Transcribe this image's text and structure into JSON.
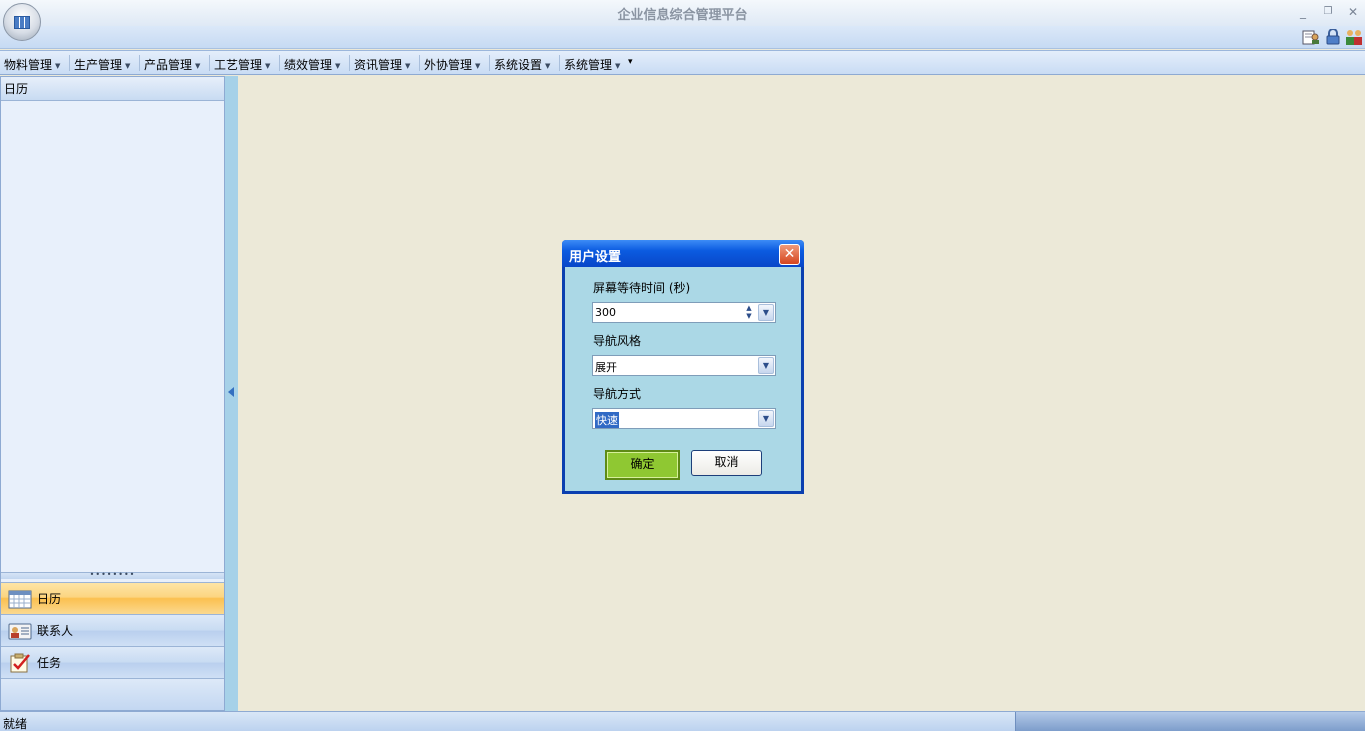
{
  "window": {
    "title": "企业信息综合管理平台",
    "minimize": "_",
    "restore": "❐",
    "close": "✕"
  },
  "menu": {
    "items": [
      {
        "label": "物料管理"
      },
      {
        "label": "生产管理"
      },
      {
        "label": "产品管理"
      },
      {
        "label": "工艺管理"
      },
      {
        "label": "绩效管理"
      },
      {
        "label": "资讯管理"
      },
      {
        "label": "外协管理"
      },
      {
        "label": "系统设置"
      },
      {
        "label": "系统管理"
      }
    ],
    "overflow": "▾"
  },
  "nav": {
    "header": "日历",
    "splitter": "••••••••",
    "buttons": [
      {
        "label": "日历",
        "icon": "calendar-icon",
        "active": true
      },
      {
        "label": "联系人",
        "icon": "contact-card-icon",
        "active": false
      },
      {
        "label": "任务",
        "icon": "task-checklist-icon",
        "active": false
      }
    ]
  },
  "dialog": {
    "title": "用户设置",
    "fields": [
      {
        "label": "屏幕等待时间 (秒)",
        "value": "300"
      },
      {
        "label": "导航风格",
        "value": "展开"
      },
      {
        "label": "导航方式",
        "value": "快速"
      }
    ],
    "ok": "确定",
    "cancel": "取消"
  },
  "status": {
    "text": "就绪"
  },
  "colors": {
    "accent_orange": "#fbc050",
    "dialog_title": "#0b5be0",
    "ok_button": "#8fc832"
  }
}
